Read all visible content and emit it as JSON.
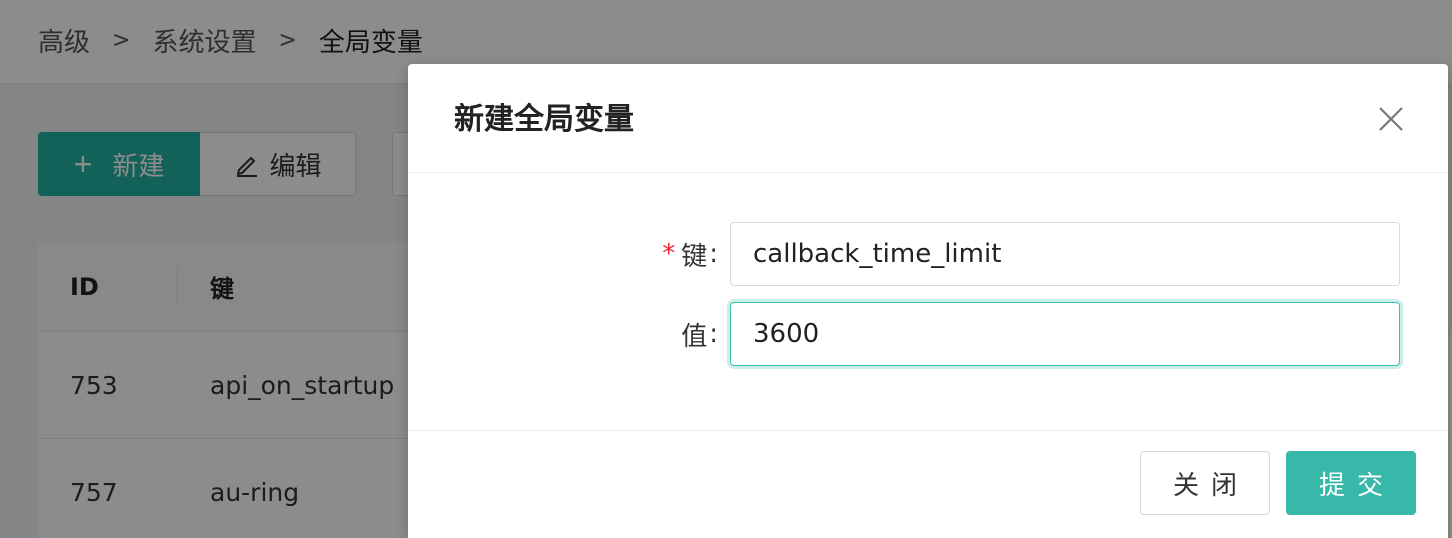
{
  "breadcrumb": {
    "items": [
      "高级",
      "系统设置",
      "全局变量"
    ],
    "separator": ">"
  },
  "toolbar": {
    "new_label": "新建",
    "new_icon": "plus-icon",
    "edit_label": "编辑",
    "edit_icon": "edit-pencil-icon"
  },
  "table": {
    "columns": [
      "ID",
      "键"
    ],
    "rows": [
      {
        "id": "753",
        "key": "api_on_startup"
      },
      {
        "id": "757",
        "key": "au-ring"
      }
    ]
  },
  "modal": {
    "title": "新建全局变量",
    "close_icon": "close-icon",
    "fields": {
      "key": {
        "label": "键",
        "required": true,
        "value": "callback_time_limit"
      },
      "value": {
        "label": "值",
        "required": false,
        "value": "3600"
      }
    },
    "colon": ":",
    "required_mark": "*",
    "close_button": "关闭",
    "submit_button": "提交"
  },
  "colors": {
    "primary": "#22b3a3",
    "submit": "#38b8a8",
    "required": "#f5222d",
    "mask": "rgba(0,0,0,0.45)"
  }
}
